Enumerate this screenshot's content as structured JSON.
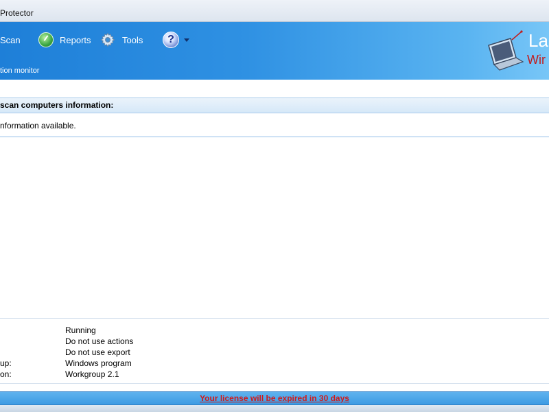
{
  "window": {
    "title": "Protector"
  },
  "toolbar": {
    "scan_label": "Scan",
    "reports_label": "Reports",
    "tools_label": "Tools",
    "help_icon": "question-mark-icon",
    "subtitle": "tion monitor"
  },
  "logo": {
    "line1": "La",
    "line2": "Wir"
  },
  "section": {
    "header": "scan computers information:",
    "message": "nformation available."
  },
  "status": {
    "rows": [
      {
        "key": "",
        "value": "Running"
      },
      {
        "key": "",
        "value": "Do not use actions"
      },
      {
        "key": "",
        "value": "Do not use export"
      },
      {
        "key": "up:",
        "value": "Windows program"
      },
      {
        "key": "on:",
        "value": "Workgroup 2.1"
      }
    ]
  },
  "footer": {
    "license_text": "Your license will be expired in 30 days"
  },
  "colors": {
    "toolbar_blue": "#2f91e3",
    "license_red": "#d11a1a",
    "logo_red": "#c21d1d"
  }
}
